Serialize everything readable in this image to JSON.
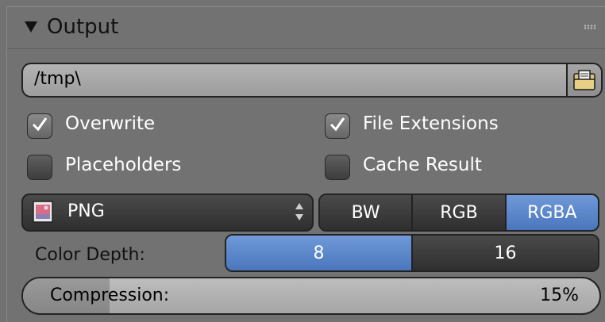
{
  "panel": {
    "title": "Output"
  },
  "path": {
    "value": "/tmp\\"
  },
  "checkboxes": [
    {
      "label": "Overwrite",
      "checked": true
    },
    {
      "label": "File Extensions",
      "checked": true
    },
    {
      "label": "Placeholders",
      "checked": false
    },
    {
      "label": "Cache Result",
      "checked": false
    }
  ],
  "file_format": {
    "selected": "PNG"
  },
  "color_mode": {
    "options": [
      "BW",
      "RGB",
      "RGBA"
    ],
    "selected": "RGBA"
  },
  "color_depth": {
    "label": "Color Depth:",
    "options": [
      "8",
      "16"
    ],
    "selected": "8"
  },
  "compression": {
    "label": "Compression:",
    "value_text": "15%",
    "value": 0.15
  },
  "colors": {
    "accent": "#5b87cc",
    "panel_bg": "#727272"
  },
  "icons": {
    "collapse": "disclosure-triangle-down",
    "folder": "file-browser-icon",
    "format": "image-file-icon",
    "dropdown": "up-down-arrows-icon"
  }
}
